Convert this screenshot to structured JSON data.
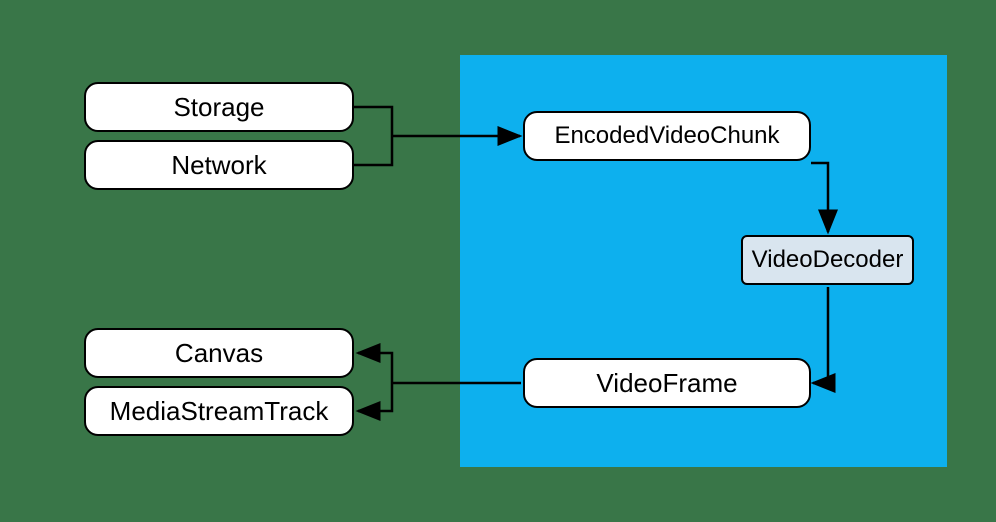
{
  "nodes": {
    "storage": "Storage",
    "network": "Network",
    "encodedVideoChunk": "EncodedVideoChunk",
    "videoDecoder": "VideoDecoder",
    "videoFrame": "VideoFrame",
    "canvas": "Canvas",
    "mediaStreamTrack": "MediaStreamTrack"
  }
}
